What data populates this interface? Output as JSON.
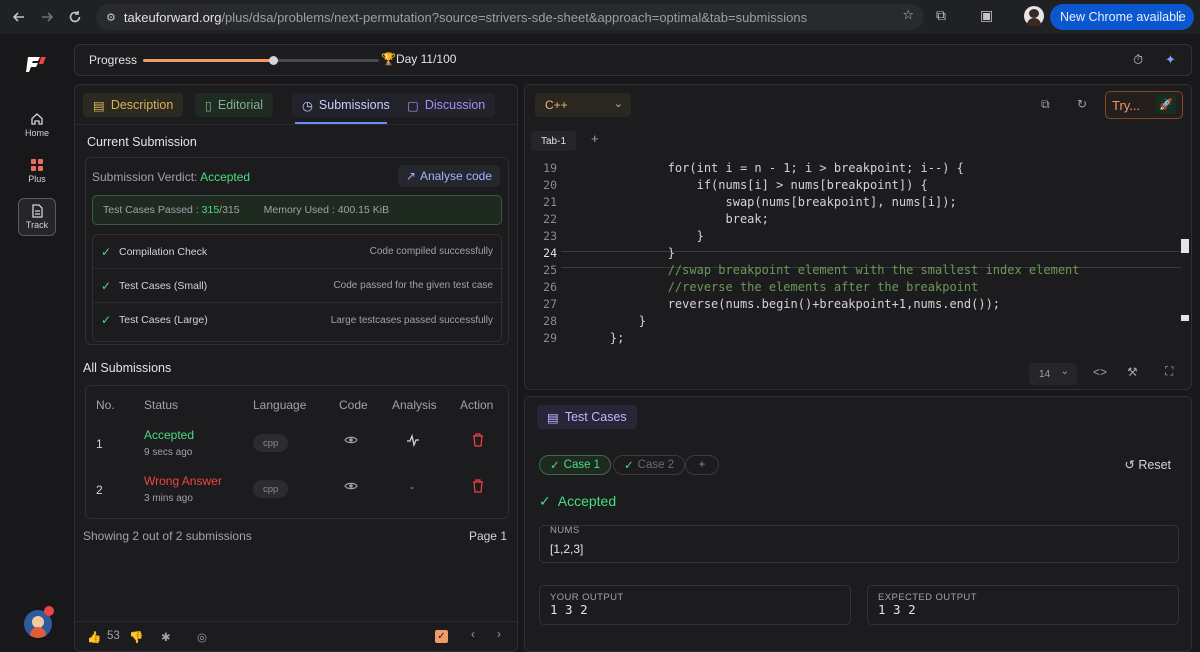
{
  "browser": {
    "url_host": "takeuforward.org",
    "url_path": "/plus/dsa/problems/next-permutation?source=strivers-sde-sheet&approach=optimal&tab=submissions",
    "update_label": "New Chrome available"
  },
  "rail": {
    "items": [
      {
        "label": "Home",
        "icon": "home-icon"
      },
      {
        "label": "Plus",
        "icon": "plus-grid-icon"
      },
      {
        "label": "Track",
        "icon": "track-doc-icon"
      }
    ]
  },
  "progress": {
    "label": "Progress",
    "day_label": "Day 11/100",
    "fraction": 0.55
  },
  "tabs": {
    "description": "Description",
    "editorial": "Editorial",
    "submissions": "Submissions",
    "discussion": "Discussion"
  },
  "current_submission": {
    "title": "Current Submission",
    "verdict_label": "Submission Verdict:",
    "verdict_value": "Accepted",
    "analyse_label": "Analyse code",
    "test_cases_label": "Test Cases Passed :",
    "test_cases_passed": "315",
    "test_cases_total": "/315",
    "memory_label": "Memory Used :",
    "memory_value": "400.15 KiB",
    "checks": [
      {
        "label": "Compilation Check",
        "desc": "Code compiled successfully"
      },
      {
        "label": "Test Cases (Small)",
        "desc": "Code passed for the given test case"
      },
      {
        "label": "Test Cases (Large)",
        "desc": "Large testcases passed successfully"
      }
    ]
  },
  "all_submissions": {
    "title": "All Submissions",
    "columns": [
      "No.",
      "Status",
      "Language",
      "Code",
      "Analysis",
      "Action"
    ],
    "rows": [
      {
        "no": "1",
        "status": "Accepted",
        "time": "9 secs ago",
        "language": "cpp",
        "analysis": ""
      },
      {
        "no": "2",
        "status": "Wrong Answer",
        "time": "3 mins ago",
        "language": "cpp",
        "analysis": "-"
      }
    ],
    "showing": "Showing 2 out of 2 submissions",
    "page": "Page 1"
  },
  "footer": {
    "likes": "53"
  },
  "editor": {
    "language": "C++",
    "try_label": "Try...",
    "tab_label": "Tab-1",
    "font_size": "14",
    "current_line": 24,
    "lines": [
      {
        "n": "19",
        "code": "            for(int i = n - 1; i > breakpoint; i--) {"
      },
      {
        "n": "20",
        "code": "                if(nums[i] > nums[breakpoint]) {"
      },
      {
        "n": "21",
        "code": "                    swap(nums[breakpoint], nums[i]);"
      },
      {
        "n": "22",
        "code": "                    break;"
      },
      {
        "n": "23",
        "code": "                }"
      },
      {
        "n": "24",
        "code": "            }"
      },
      {
        "n": "25",
        "code": "            //swap breakpoint element with the smallest index element"
      },
      {
        "n": "26",
        "code": "            //reverse the elements after the breakpoint"
      },
      {
        "n": "27",
        "code": "            reverse(nums.begin()+breakpoint+1,nums.end());"
      },
      {
        "n": "28",
        "code": "        }"
      },
      {
        "n": "29",
        "code": "    };"
      }
    ]
  },
  "test_cases": {
    "header": "Test Cases",
    "cases": [
      "Case 1",
      "Case 2"
    ],
    "reset_label": "Reset",
    "verdict": "Accepted",
    "input_label": "NUMS",
    "input_value": "[1,2,3]",
    "your_output_label": "YOUR OUTPUT",
    "your_output": "1 3 2",
    "expected_output_label": "EXPECTED OUTPUT",
    "expected_output": "1 3 2"
  },
  "colors": {
    "accent_orange": "#f09a6a",
    "success": "#4ade80",
    "error": "#ef4444",
    "link_blue": "#6b8afd"
  }
}
